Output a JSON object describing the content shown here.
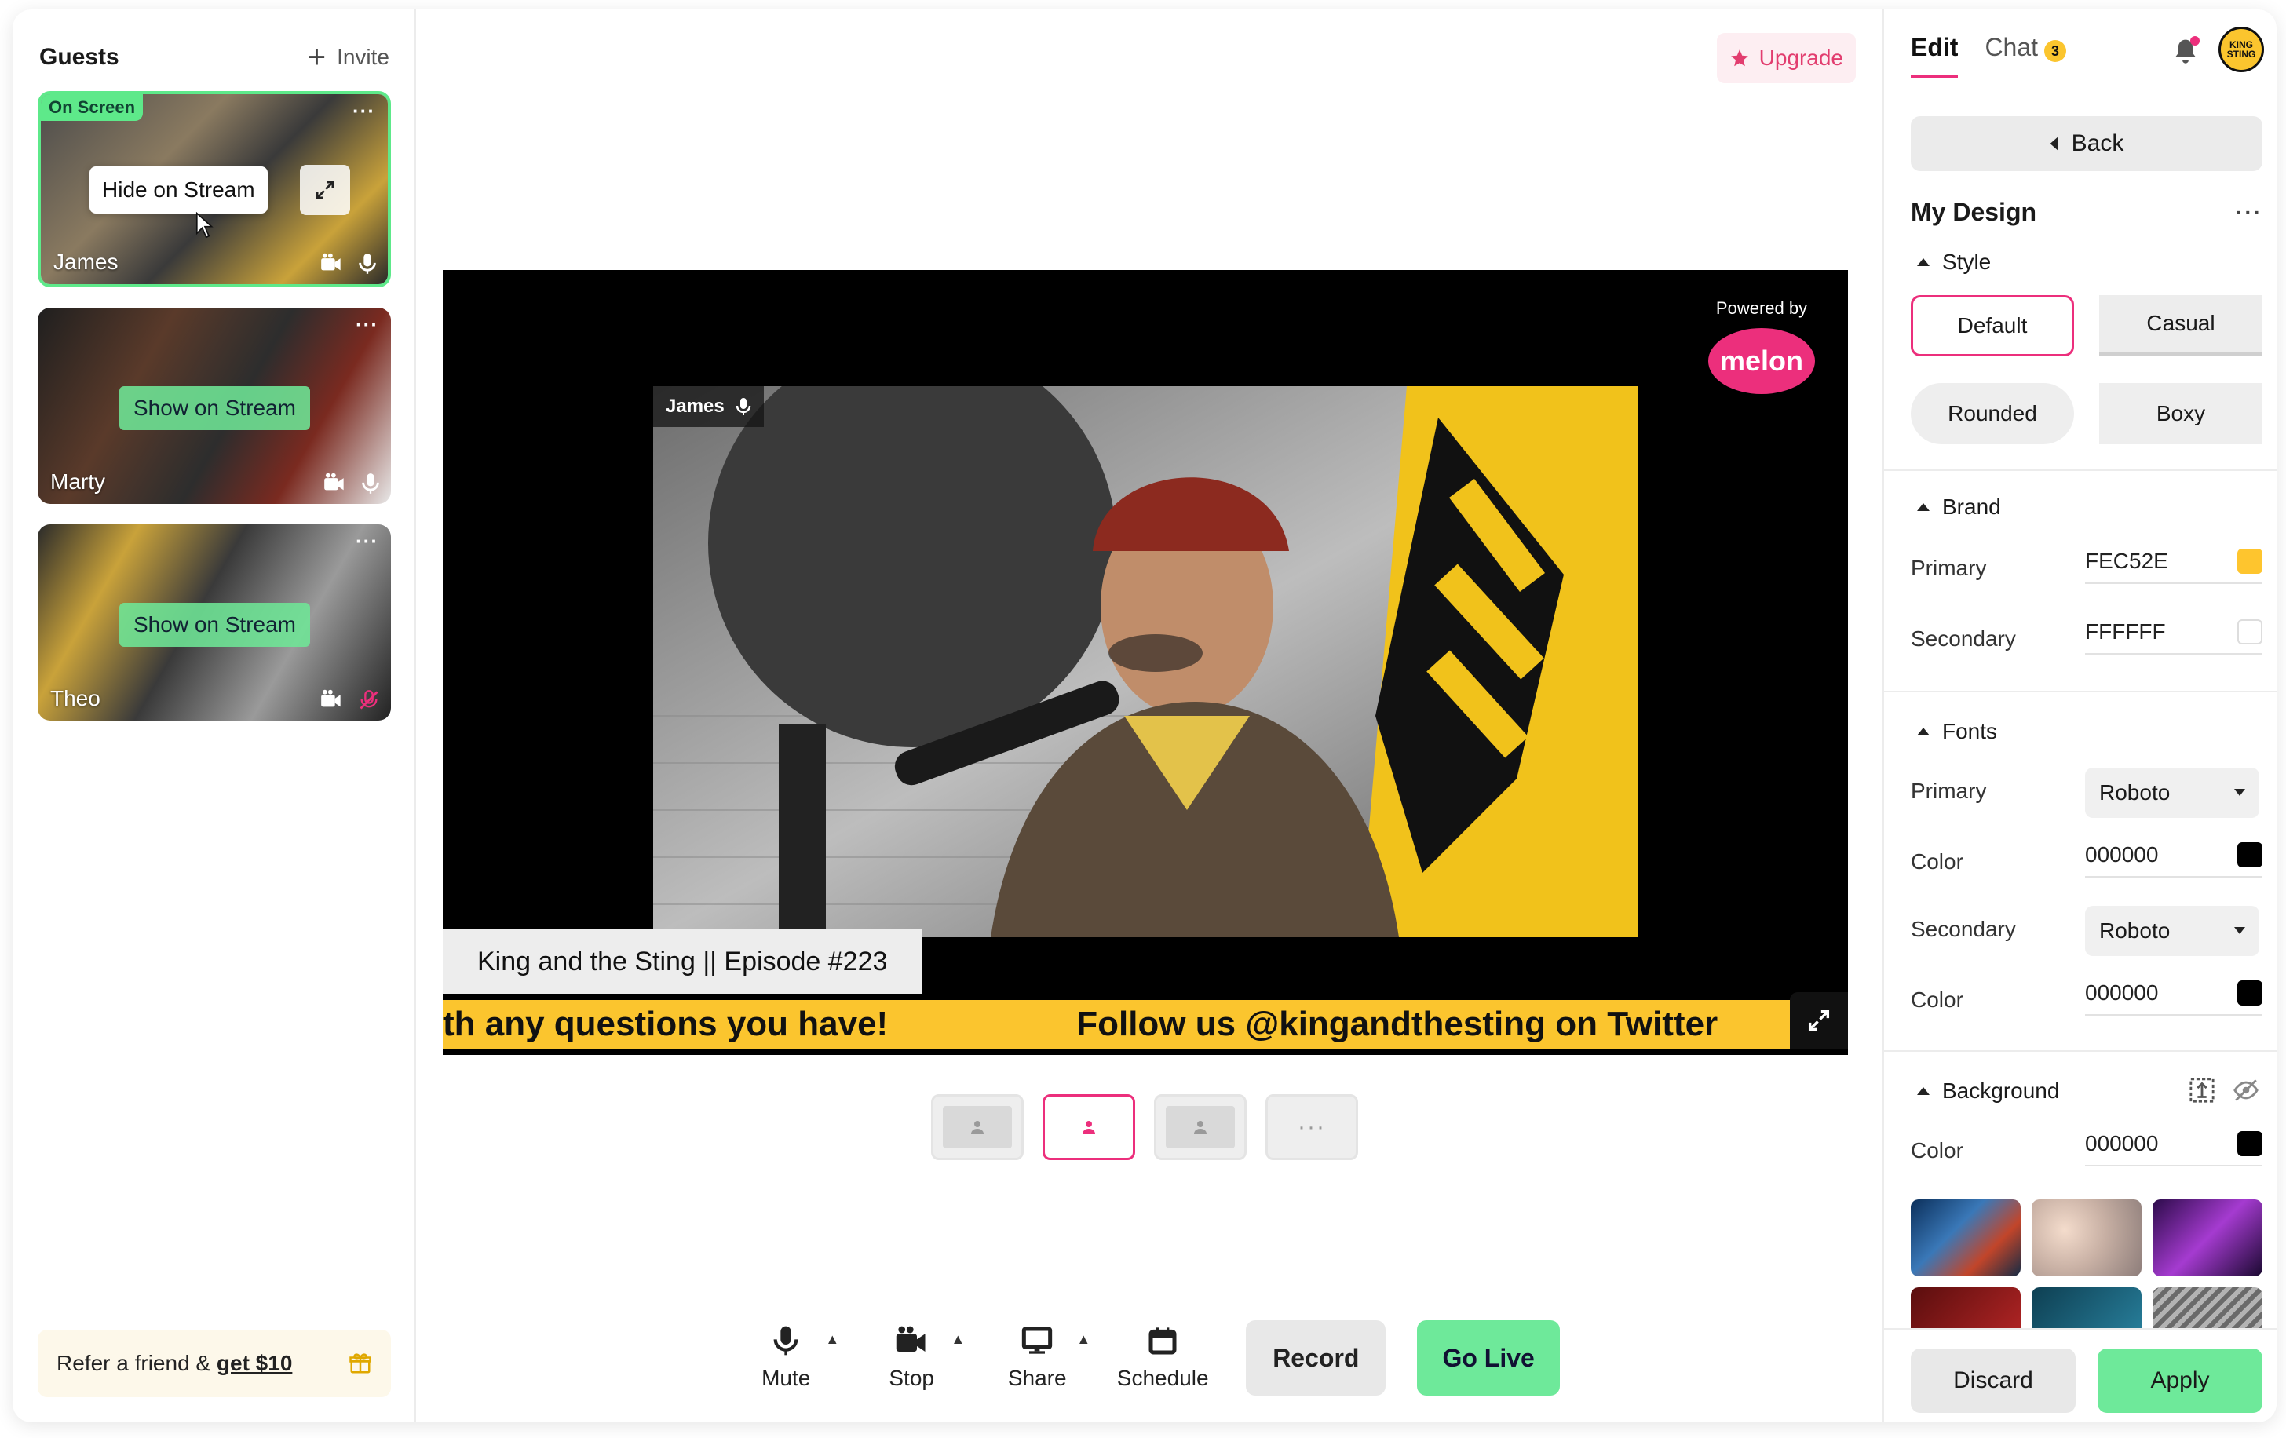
{
  "guests": {
    "title": "Guests",
    "invite_label": "Invite",
    "on_screen_badge": "On Screen",
    "hide_on_stream": "Hide on Stream",
    "show_on_stream": "Show on Stream",
    "items": [
      {
        "name": "James"
      },
      {
        "name": "Marty"
      },
      {
        "name": "Theo"
      }
    ],
    "refer_text": "Refer a friend &",
    "refer_link": "get $10"
  },
  "main": {
    "upgrade_label": "Upgrade",
    "powered_by": "Powered by",
    "brand_logo": "melon",
    "video_name_tag": "James",
    "episode_title": "King and the Sting || Episode #223",
    "ticker": [
      "th any questions you have!",
      "Follow us @kingandthesting on Twitter"
    ],
    "controls": [
      {
        "label": "Mute",
        "icon": "microphone-icon"
      },
      {
        "label": "Stop",
        "icon": "camera-icon"
      },
      {
        "label": "Share",
        "icon": "monitor-icon"
      },
      {
        "label": "Schedule",
        "icon": "calendar-icon"
      }
    ],
    "record_label": "Record",
    "go_live_label": "Go Live"
  },
  "panel": {
    "tabs": [
      {
        "label": "Edit"
      },
      {
        "label": "Chat",
        "count": "3"
      }
    ],
    "avatar_text": "KING STING",
    "back_label": "Back",
    "design_title": "My Design",
    "style": {
      "title": "Style",
      "options": [
        "Default",
        "Casual",
        "Rounded",
        "Boxy"
      ]
    },
    "brand": {
      "title": "Brand",
      "primary_label": "Primary",
      "primary_value": "FEC52E",
      "secondary_label": "Secondary",
      "secondary_value": "FFFFFF"
    },
    "fonts": {
      "title": "Fonts",
      "primary_label": "Primary",
      "primary_value": "Roboto",
      "color1_label": "Color",
      "color1_value": "000000",
      "secondary_label": "Secondary",
      "secondary_value": "Roboto",
      "color2_label": "Color",
      "color2_value": "000000"
    },
    "background": {
      "title": "Background",
      "color_label": "Color",
      "color_value": "000000"
    },
    "discard_label": "Discard",
    "apply_label": "Apply"
  },
  "colors": {
    "accent_pink": "#ec2f7c",
    "brand_yellow": "#fec52e",
    "live_green": "#6ee99a"
  }
}
